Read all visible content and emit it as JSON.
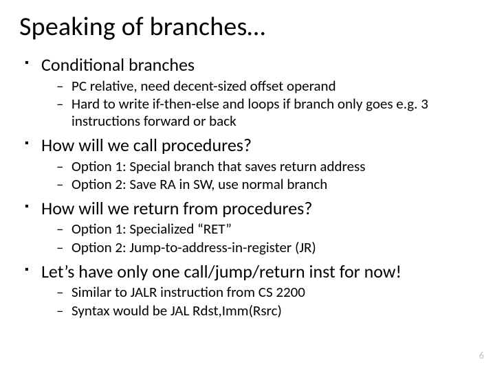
{
  "title": "Speaking of branches…",
  "bullets": [
    {
      "text": "Conditional branches",
      "sub": [
        "PC relative, need decent-sized offset operand",
        "Hard to write if-then-else and loops if branch only goes e.g. 3 instructions forward or back"
      ]
    },
    {
      "text": "How will we call procedures?",
      "sub": [
        "Option 1: Special branch that saves return address",
        "Option 2: Save RA in SW, use normal branch"
      ]
    },
    {
      "text": "How will we return from procedures?",
      "sub": [
        "Option 1: Specialized “RET”",
        "Option 2: Jump-to-address-in-register (JR)"
      ]
    },
    {
      "text": "Let’s have only one call/jump/return inst for now!",
      "sub": [
        "Similar to JALR instruction from CS 2200",
        "Syntax would be JAL Rdst,Imm(Rsrc)"
      ]
    }
  ],
  "page_number": "6"
}
